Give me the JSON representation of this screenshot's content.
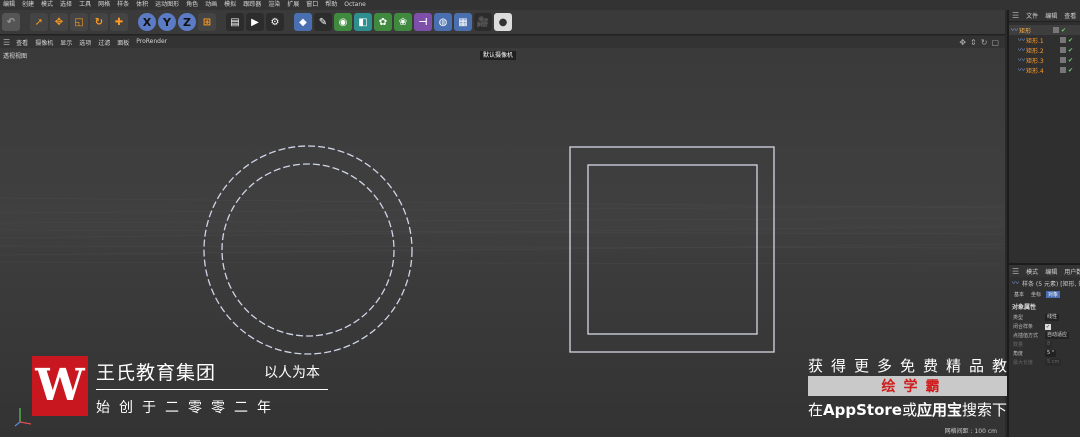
{
  "menu": [
    "编辑",
    "创建",
    "模式",
    "选择",
    "工具",
    "网格",
    "样条",
    "体积",
    "运动图形",
    "角色",
    "动画",
    "模拟",
    "跟踪器",
    "渲染",
    "扩展",
    "窗口",
    "帮助",
    "Octane"
  ],
  "toolbar_icons": [
    "undo-icon",
    "sep",
    "select-icon",
    "move-icon",
    "scale-icon",
    "rotate-icon",
    "add-icon",
    "sep",
    "x-axis-icon",
    "y-axis-icon",
    "z-axis-icon",
    "coordinate-icon",
    "sep",
    "render-region-icon",
    "render-view-icon",
    "render-settings-icon",
    "sep",
    "cube-icon",
    "pen-icon",
    "subdivision-icon",
    "extrude-icon",
    "cloner-icon",
    "effector-icon",
    "deformer-icon",
    "environment-icon",
    "floor-icon",
    "camera-icon",
    "light-icon"
  ],
  "toolbar_axis": {
    "x": "X",
    "y": "Y",
    "z": "Z"
  },
  "viewport_menu": [
    "查看",
    "摄像机",
    "显示",
    "选项",
    "过滤",
    "面板",
    "ProRender"
  ],
  "viewport": {
    "label": "透视视图",
    "camera": "默认摄像机",
    "grid_info": "网格间距 : 100 cm"
  },
  "watermark": {
    "logo_letter": "W",
    "title": "王氏教育集团",
    "slogan": "以人为本",
    "subtitle": "始创于二零零二年"
  },
  "promo": {
    "line1": "获得更多免费精品教程",
    "brand": "绘学霸",
    "line2_prefix": "在",
    "line2_store": "AppStore",
    "line2_or": "或",
    "line2_app": "应用宝",
    "line2_suffix": "搜索下载"
  },
  "object_manager": {
    "tabs": [
      "文件",
      "编辑",
      "查看"
    ],
    "objects": [
      {
        "name": "矩形",
        "parent": true
      },
      {
        "name": "矩形.1",
        "parent": false
      },
      {
        "name": "矩形.2",
        "parent": false
      },
      {
        "name": "矩形.3",
        "parent": false
      },
      {
        "name": "矩形.4",
        "parent": false
      }
    ]
  },
  "attributes": {
    "tabs": [
      "模式",
      "编辑",
      "用户数据"
    ],
    "title": "样条 (5 元素) [矩形, 矩",
    "subtabs": [
      "基本",
      "坐标",
      "对象"
    ],
    "active_subtab": "对象",
    "section": "对象属性",
    "rows": [
      {
        "label": "类型",
        "value": "线性",
        "dim": false
      },
      {
        "label": "闭合样条",
        "value": "✓",
        "checkbox": true,
        "dim": false
      },
      {
        "label": "点插值方式",
        "value": "自动适应",
        "dim": false
      },
      {
        "label": "数量",
        "value": "8",
        "dim": true
      },
      {
        "label": "角度",
        "value": "5 °",
        "dim": false
      },
      {
        "label": "最大长度",
        "value": "5 cm",
        "dim": true
      }
    ]
  }
}
